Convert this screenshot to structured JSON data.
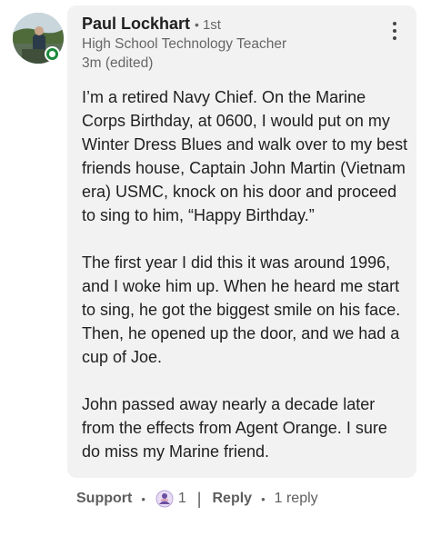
{
  "comment": {
    "author_name": "Paul Lockhart",
    "degree": "1st",
    "headline": "High School Technology Teacher",
    "timestamp": "3m (edited)",
    "paragraphs": [
      "I’m a retired Navy Chief. On the Marine Corps Birthday, at 0600, I would put on my Winter Dress Blues and walk over to my best friends house, Captain John Martin (Vietnam era) USMC, knock on his door and proceed to sing to him, “Happy Birthday.”",
      "The first year I did this it was around 1996, and I woke him up. When he heard me start to sing, he got the biggest smile on his face. Then, he opened up the door, and we had a cup of Joe.",
      "John passed away nearly a decade later from the effects from Agent Orange. I sure do miss my Marine friend."
    ]
  },
  "actions": {
    "support_label": "Support",
    "reaction_count": "1",
    "reply_label": "Reply",
    "replies_text": "1 reply"
  },
  "icons": {
    "more": "more-vertical-icon",
    "reaction": "support-reaction-icon"
  },
  "colors": {
    "bubble_bg": "#f2f2f2",
    "online_green": "#1b8a3a",
    "support_purple": "#6a4ea0"
  }
}
